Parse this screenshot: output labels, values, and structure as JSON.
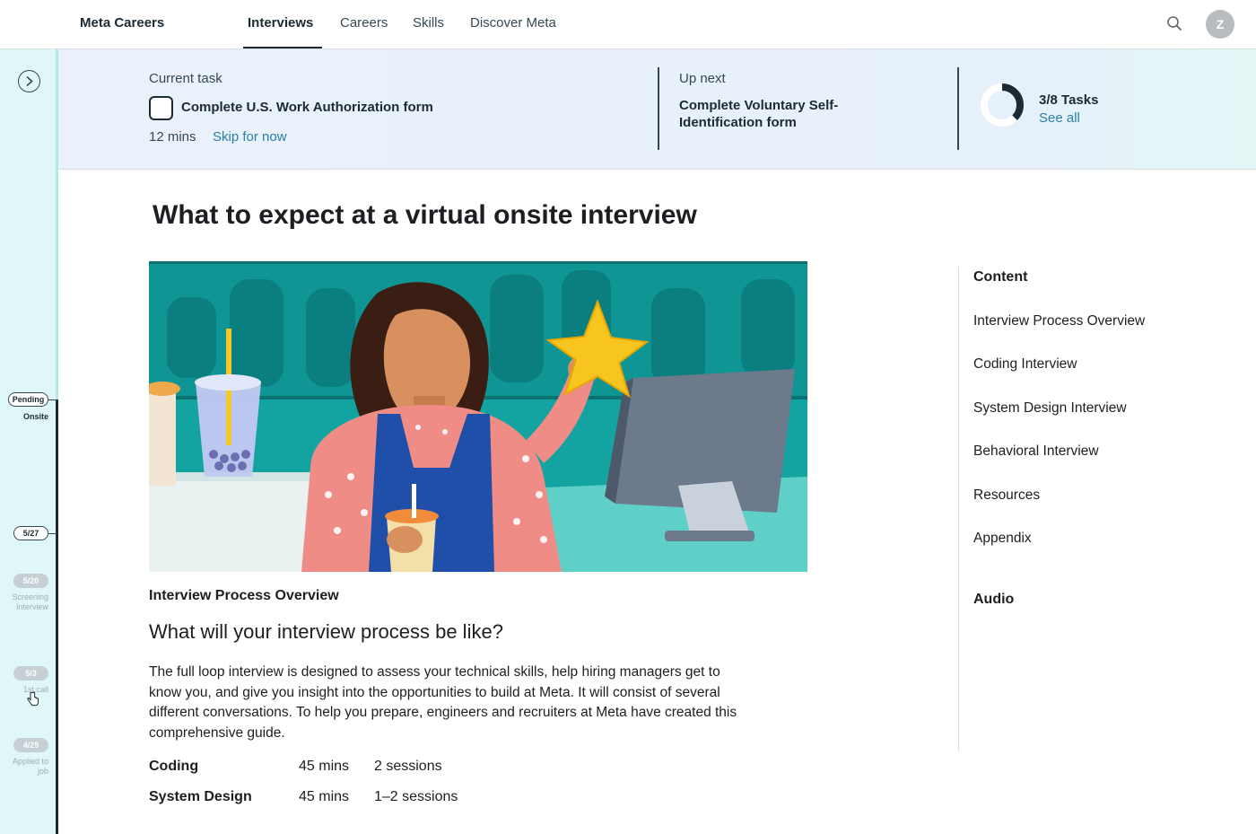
{
  "nav": {
    "brand": "Meta Careers",
    "links": [
      "Interviews",
      "Careers",
      "Skills",
      "Discover Meta"
    ],
    "avatar_initial": "Z"
  },
  "timeline": {
    "current": {
      "badge": "Pending",
      "label": "Onsite"
    },
    "entries": [
      {
        "date": "5/27",
        "label": ""
      },
      {
        "date": "5/20",
        "label": "Screening Interview"
      },
      {
        "date": "5/3",
        "label": "1st call"
      },
      {
        "date": "4/29",
        "label": "Applied to job"
      }
    ]
  },
  "banner": {
    "current_label": "Current task",
    "current_task": "Complete U.S. Work Authorization form",
    "duration": "12 mins",
    "skip": "Skip for now",
    "next_label": "Up next",
    "next_task": "Complete Voluntary Self-Identification form",
    "progress": "3/8 Tasks",
    "progress_fraction": 0.375,
    "see_all": "See all"
  },
  "article": {
    "title": "What to expect at a virtual onsite interview",
    "section_label": "Interview Process Overview",
    "section_question": "What will your interview process be like?",
    "body": "The full loop interview is designed to assess your technical skills, help hiring managers get to know you, and give you insight into the opportunities to build at Meta. It will consist of several different conversations. To help you prepare, engineers and recruiters at Meta have created this comprehensive guide.",
    "schedule": [
      {
        "name": "Coding",
        "duration": "45 mins",
        "sessions": "2 sessions"
      },
      {
        "name": "System Design",
        "duration": "45 mins",
        "sessions": "1–2 sessions"
      }
    ]
  },
  "toc": {
    "heading": "Content",
    "items": [
      "Interview Process Overview",
      "Coding Interview",
      "System Design Interview",
      "Behavioral Interview",
      "Resources",
      "Appendix"
    ],
    "audio_heading": "Audio"
  },
  "colors": {
    "accent_link": "#2a7fa6",
    "sidebar_bg": "#dff7f7",
    "banner_bg": "#eaf1fb"
  }
}
